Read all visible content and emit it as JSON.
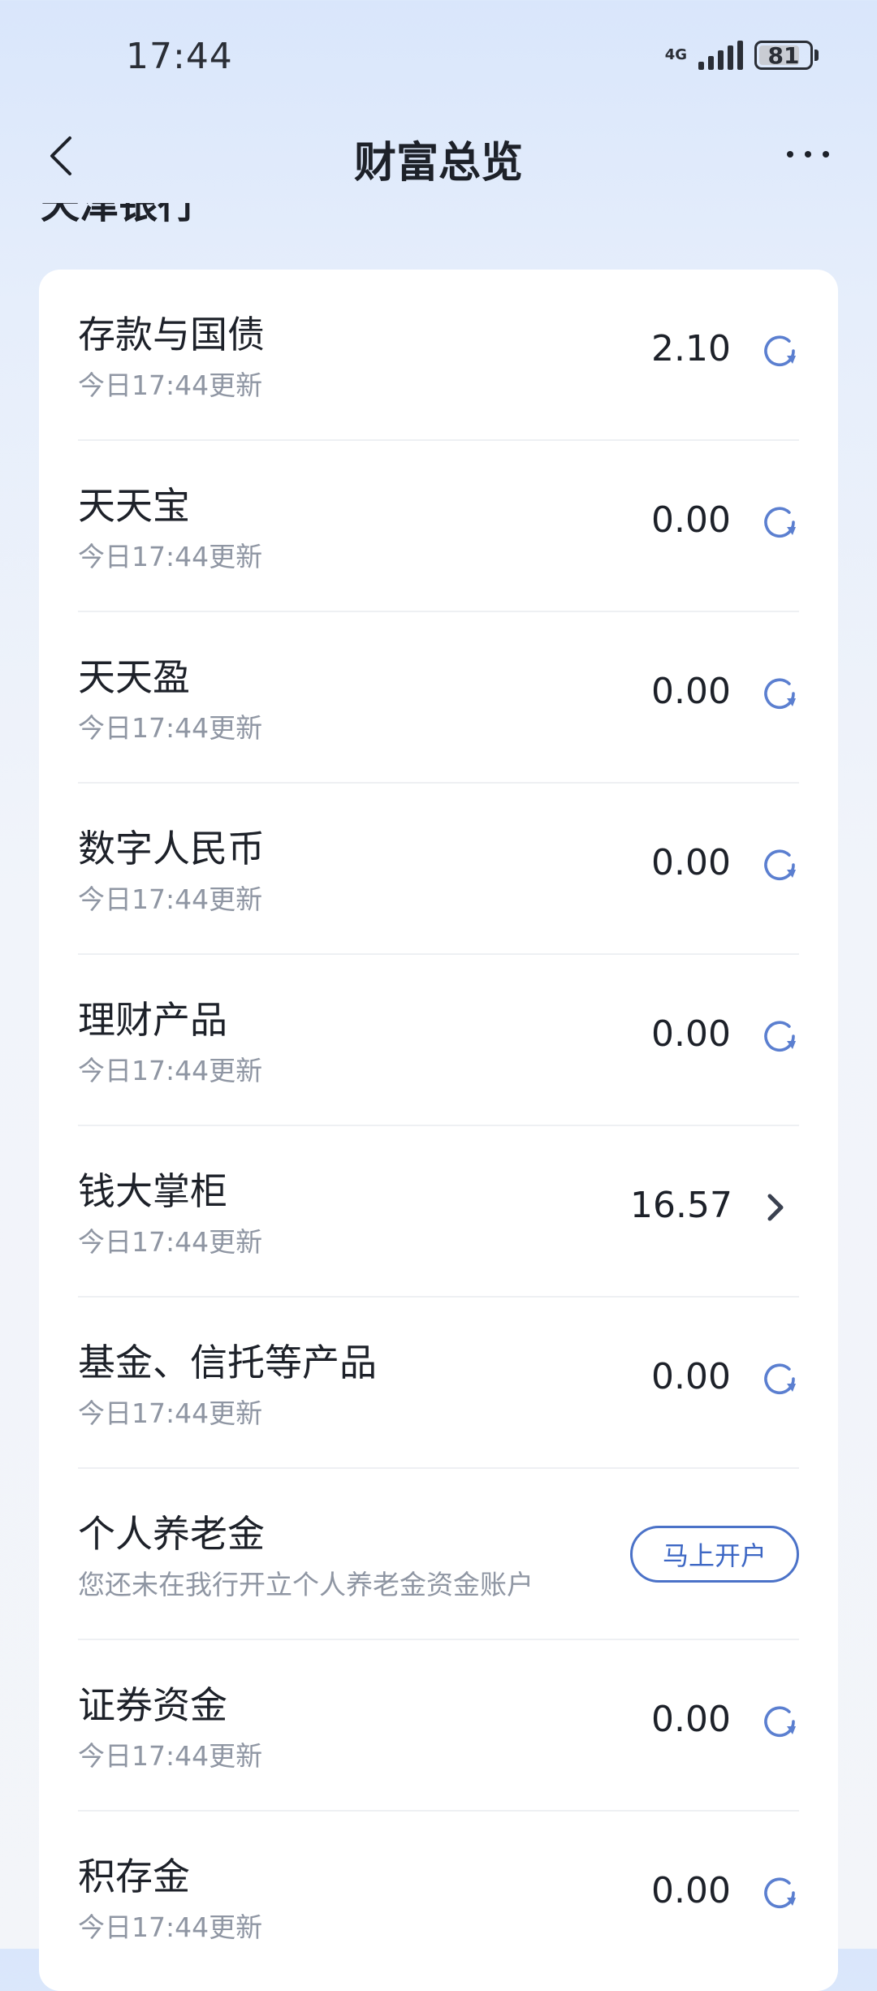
{
  "status_bar": {
    "time": "17:44",
    "network": "4G",
    "battery": "81",
    "battery_level": 0.81
  },
  "nav": {
    "title": "财富总览"
  },
  "section": {
    "title": "天津银行"
  },
  "items": [
    {
      "title": "存款与国债",
      "subtitle": "今日17:44更新",
      "value": "2.10",
      "action": "refresh"
    },
    {
      "title": "天天宝",
      "subtitle": "今日17:44更新",
      "value": "0.00",
      "action": "refresh"
    },
    {
      "title": "天天盈",
      "subtitle": "今日17:44更新",
      "value": "0.00",
      "action": "refresh"
    },
    {
      "title": "数字人民币",
      "subtitle": "今日17:44更新",
      "value": "0.00",
      "action": "refresh"
    },
    {
      "title": "理财产品",
      "subtitle": "今日17:44更新",
      "value": "0.00",
      "action": "refresh"
    },
    {
      "title": "钱大掌柜",
      "subtitle": "今日17:44更新",
      "value": "16.57",
      "action": "chevron"
    },
    {
      "title": "基金、信托等产品",
      "subtitle": "今日17:44更新",
      "value": "0.00",
      "action": "refresh"
    },
    {
      "title": "个人养老金",
      "subtitle": "您还未在我行开立个人养老金资金账户",
      "button": "马上开户",
      "action": "button"
    },
    {
      "title": "证券资金",
      "subtitle": "今日17:44更新",
      "value": "0.00",
      "action": "refresh"
    },
    {
      "title": "积存金",
      "subtitle": "今日17:44更新",
      "value": "0.00",
      "action": "refresh"
    }
  ],
  "colors": {
    "accent": "#4b72c8",
    "icon_blue": "#5b7fd0",
    "text_primary": "#1d2129",
    "text_secondary": "#8f96a3"
  }
}
